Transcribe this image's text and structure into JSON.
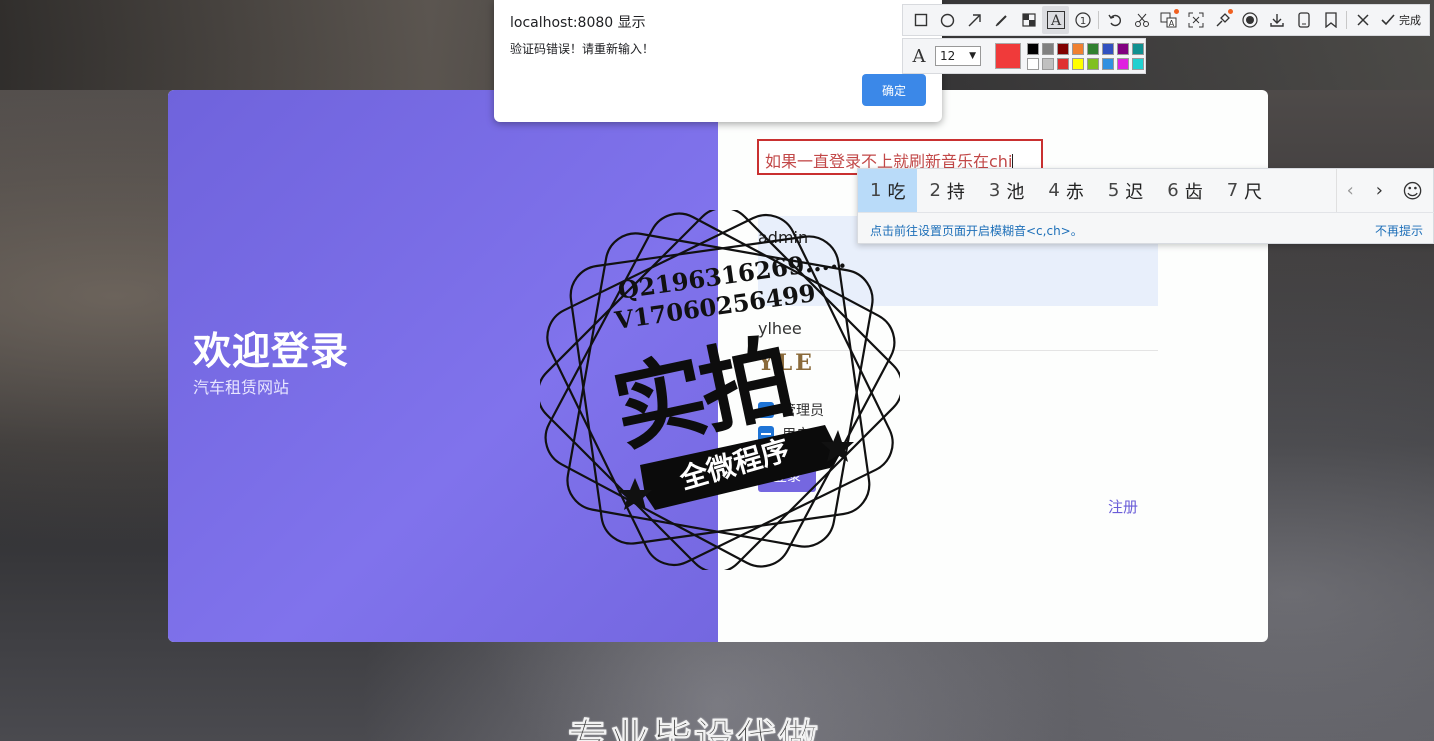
{
  "background": {
    "caption": "专业毕设代做"
  },
  "login": {
    "welcome_title": "欢迎登录",
    "welcome_subtitle": "汽车租赁网站",
    "input_text": "如果一直登录不上就刷新音乐在chi",
    "username_value": "admin",
    "password_value": "ylhee",
    "captcha_text": "YLE",
    "radio_admin": "管理员",
    "radio_user": "用户",
    "login_button": "登录",
    "register_link": "注册",
    "colors": {
      "accent": "#7567e0",
      "panel": "#8073ec"
    }
  },
  "alert": {
    "title": "localhost:8080 显示",
    "message": "验证码错误！请重新输入！",
    "ok_label": "确定"
  },
  "toolbar": {
    "icons": [
      "rect-icon",
      "ellipse-icon",
      "arrow-icon",
      "pen-icon",
      "mosaic-icon",
      "text-icon",
      "number-icon",
      "undo-icon",
      "crop-icon",
      "translate-icon",
      "ocr-icon",
      "pin-icon",
      "record-icon",
      "download-icon",
      "phone-icon",
      "bookmark-icon",
      "close-icon",
      "check-icon"
    ],
    "done_label": "完成",
    "font_size": "12",
    "current_color": "#f03a3a",
    "palette": [
      "#000000",
      "#808080",
      "#800000",
      "#f08030",
      "#308030",
      "#3050c0",
      "#800080",
      "#109090",
      "#ffffff",
      "#c0c0c0",
      "#e03030",
      "#ffff00",
      "#80c020",
      "#3090e0",
      "#e020e0",
      "#20d0d0"
    ]
  },
  "ime": {
    "candidates": [
      {
        "num": "1",
        "char": "吃"
      },
      {
        "num": "2",
        "char": "持"
      },
      {
        "num": "3",
        "char": "池"
      },
      {
        "num": "4",
        "char": "赤"
      },
      {
        "num": "5",
        "char": "迟"
      },
      {
        "num": "6",
        "char": "齿"
      },
      {
        "num": "7",
        "char": "尺"
      }
    ],
    "hint": "点击前往设置页面开启模糊音<c,ch>。",
    "dismiss": "不再提示"
  },
  "watermark": {
    "line1": "Q2196316269.....",
    "line2": "V17060256499",
    "big": "实拍",
    "ribbon": "全微程序"
  }
}
